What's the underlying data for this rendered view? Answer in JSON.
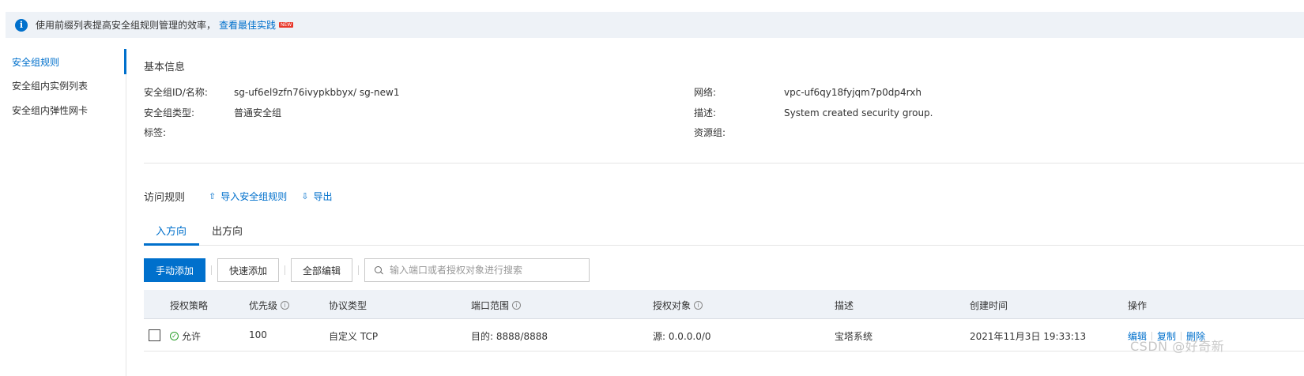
{
  "banner": {
    "text": "使用前缀列表提高安全组规则管理的效率，",
    "link": "查看最佳实践",
    "badge": "NEW"
  },
  "sidebar": {
    "items": [
      {
        "label": "安全组规则",
        "active": true
      },
      {
        "label": "安全组内实例列表",
        "active": false
      },
      {
        "label": "安全组内弹性网卡",
        "active": false
      }
    ]
  },
  "basic_info": {
    "title": "基本信息",
    "fields": [
      {
        "label": "安全组ID/名称:",
        "value": "sg-uf6el9zfn76ivypkbbyx/ sg-new1"
      },
      {
        "label": "安全组类型:",
        "value": "普通安全组"
      },
      {
        "label": "标签:",
        "value": ""
      },
      {
        "label": "网络:",
        "value": "vpc-uf6qy18fyjqm7p0dp4rxh"
      },
      {
        "label": "描述:",
        "value": "System created security group."
      },
      {
        "label": "资源组:",
        "value": ""
      }
    ]
  },
  "rules": {
    "title": "访问规则",
    "import_label": "导入安全组规则",
    "export_label": "导出"
  },
  "tabs": [
    {
      "label": "入方向",
      "active": true
    },
    {
      "label": "出方向",
      "active": false
    }
  ],
  "toolbar": {
    "manual_add": "手动添加",
    "quick_add": "快速添加",
    "edit_all": "全部编辑",
    "search_placeholder": "输入端口或者授权对象进行搜索"
  },
  "table": {
    "columns": [
      "授权策略",
      "优先级",
      "协议类型",
      "端口范围",
      "授权对象",
      "描述",
      "创建时间",
      "操作"
    ],
    "rows": [
      {
        "policy": "允许",
        "priority": "100",
        "protocol": "自定义 TCP",
        "port": "目的: 8888/8888",
        "source": "源: 0.0.0.0/0",
        "description": "宝塔系统",
        "created": "2021年11月3日 19:33:13",
        "ops": [
          "编辑",
          "复制",
          "删除"
        ]
      }
    ]
  },
  "watermark": "CSDN @好奇新",
  "colors": {
    "accent": "#0070cc",
    "banner_bg": "#eef2f7",
    "allow_green": "#2ca02c"
  }
}
